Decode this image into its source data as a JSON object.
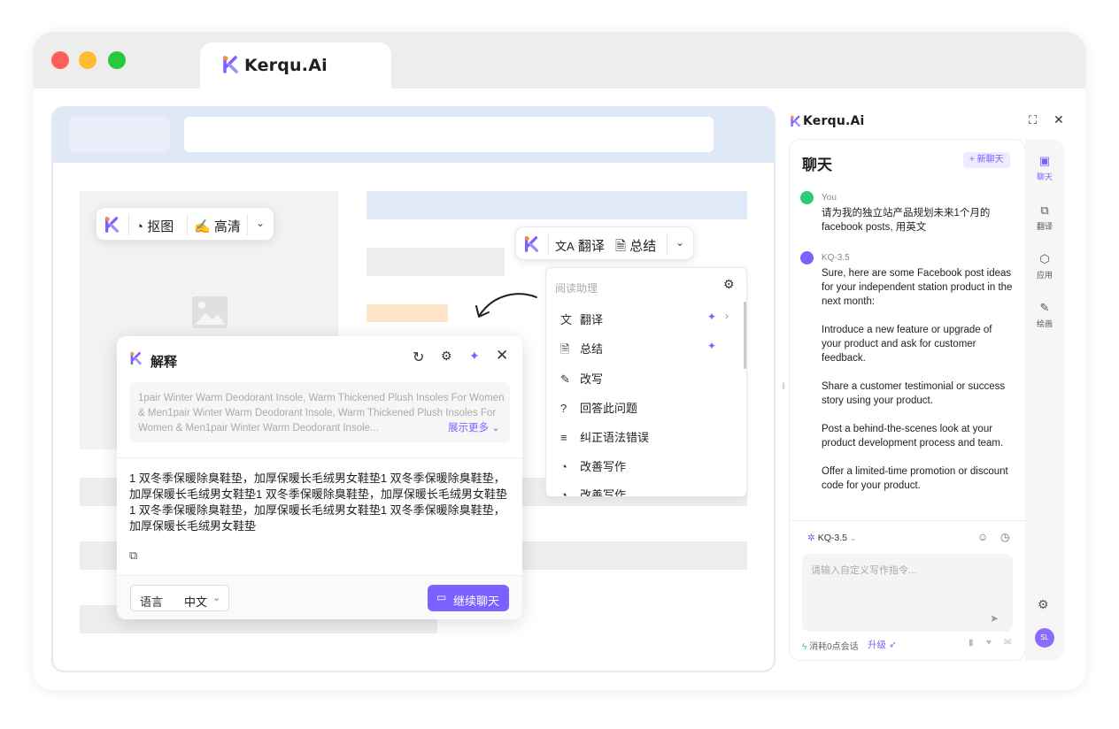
{
  "browser": {
    "tab_title": "Kerqu.Ai"
  },
  "image_toolbar": {
    "matting_label": "抠图",
    "hd_label": "高清"
  },
  "text_toolbar": {
    "translate_label": "翻译",
    "summarize_label": "总结"
  },
  "reading_menu": {
    "title": "阅读助理",
    "items": [
      {
        "label": "翻译",
        "pinned": true,
        "has_submenu": true
      },
      {
        "label": "总结",
        "pinned": true
      },
      {
        "label": "改写"
      },
      {
        "label": "回答此问题"
      },
      {
        "label": "纠正语法错误"
      },
      {
        "label": "改善写作"
      },
      {
        "label": "改善写作"
      }
    ]
  },
  "explain_popup": {
    "title": "解释",
    "source_text": "1pair Winter Warm Deodorant Insole, Warm Thickened Plush Insoles For Women & Men1pair Winter Warm Deodorant Insole, Warm Thickened Plush Insoles For Women & Men1pair Winter Warm Deodorant Insole...",
    "show_more": "展示更多",
    "result_text": "1 双冬季保暖除臭鞋垫，加厚保暖长毛绒男女鞋垫1 双冬季保暖除臭鞋垫，加厚保暖长毛绒男女鞋垫1 双冬季保暖除臭鞋垫，加厚保暖长毛绒男女鞋垫1 双冬季保暖除臭鞋垫，加厚保暖长毛绒男女鞋垫1 双冬季保暖除臭鞋垫，加厚保暖长毛绒男女鞋垫",
    "language_label": "语言",
    "language_value": "中文",
    "continue_chat": "继续聊天"
  },
  "sidebar": {
    "brand": "Kerqu.Ai",
    "chat_title": "聊天",
    "new_chat": "+ 新聊天",
    "messages": [
      {
        "sender": "You",
        "text": "请为我的独立站产品规划未来1个月的facebook posts, 用英文"
      },
      {
        "sender": "KQ-3.5",
        "text": "Sure, here are some Facebook post ideas for your independent station product in the next month:\n\nIntroduce a new feature or upgrade of your product and ask for customer feedback.\n\nShare a customer testimonial or success story using your product.\n\nPost a behind-the-scenes look at your product development process and team.\n\nOffer a limited-time promotion or discount code for your product."
      }
    ],
    "model_selector": "KQ-3.5",
    "input_placeholder": "请输入自定义写作指令...",
    "usage_text": "消耗0点会话",
    "upgrade_label": "升级",
    "rail": [
      {
        "label": "聊天",
        "icon": "chat-icon",
        "active": true
      },
      {
        "label": "翻译",
        "icon": "translate-icon"
      },
      {
        "label": "应用",
        "icon": "apps-icon"
      },
      {
        "label": "绘画",
        "icon": "paint-icon"
      }
    ],
    "user_initials": "SL"
  },
  "colors": {
    "accent": "#7b61ff",
    "page_header": "#dfe8f7",
    "highlight_blue": "#e1eaf9",
    "highlight_orange": "#fde5c8",
    "placeholder_gray": "#ededed",
    "mac_red": "#ff5f57",
    "mac_yellow": "#febc2e",
    "mac_green": "#28c840"
  }
}
